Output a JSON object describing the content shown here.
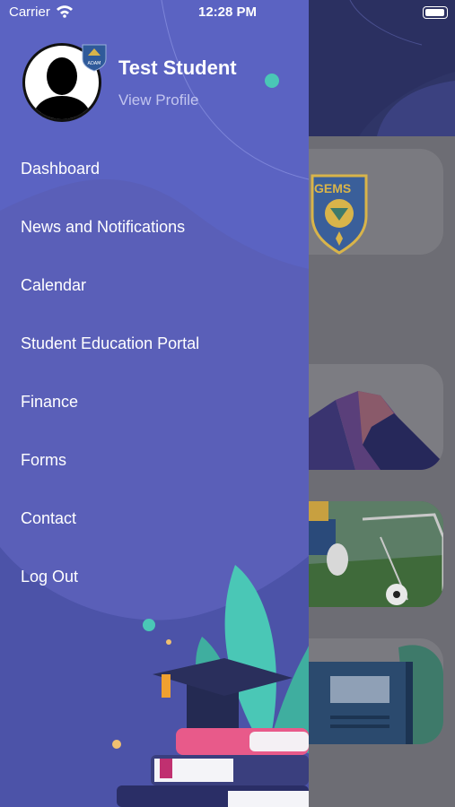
{
  "status_bar": {
    "carrier": "Carrier",
    "time": "12:28 PM"
  },
  "profile": {
    "name": "Test Student",
    "link": "View Profile",
    "badge_text": "ADAM"
  },
  "menu": [
    {
      "label": "Dashboard"
    },
    {
      "label": "News and Notifications"
    },
    {
      "label": "Calendar"
    },
    {
      "label": "Student Education Portal"
    },
    {
      "label": "Finance"
    },
    {
      "label": "Forms"
    },
    {
      "label": "Contact"
    },
    {
      "label": "Log Out"
    }
  ],
  "main": {
    "school_logo_text": "GEMS"
  },
  "colors": {
    "drawer": "#5a5fb8",
    "accent_dot": "#4ac7b6",
    "main_header": "#2f3567"
  }
}
